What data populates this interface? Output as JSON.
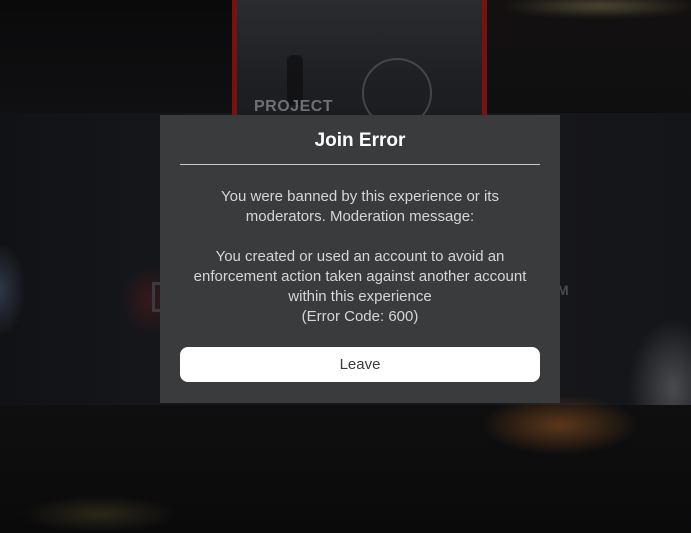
{
  "background": {
    "poster_label": "PROJECT",
    "side_text": "M"
  },
  "dialog": {
    "title": "Join Error",
    "message": "You were banned by this experience or its moderators. Moderation message:\n\nYou created or used an account to avoid an enforcement action taken against another account within this experience\n(Error Code: 600)",
    "button_label": "Leave"
  },
  "colors": {
    "dialog_background": "#393b3d",
    "button_background": "#ffffff",
    "title_text": "#ffffff",
    "body_text": "#d6d6d6",
    "poster_frame": "#7a1111"
  }
}
